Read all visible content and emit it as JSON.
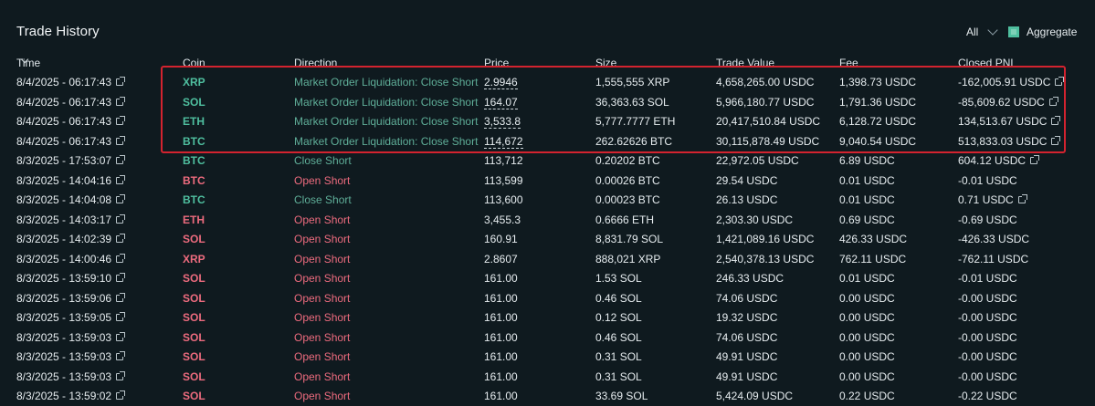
{
  "header": {
    "title": "Trade History",
    "filter_label": "All",
    "aggregate_label": "Aggregate",
    "aggregate_checked": true
  },
  "columns": {
    "time": "Time",
    "coin": "Coin",
    "direction": "Direction",
    "price": "Price",
    "size": "Size",
    "trade_value": "Trade Value",
    "fee": "Fee",
    "closed_pnl": "Closed PNL"
  },
  "colors": {
    "buy": "#4fbf9f",
    "sell": "#ed6b7e",
    "highlight": "#d3232f"
  },
  "rows": [
    {
      "time": "8/4/2025 - 06:17:43",
      "coin": "XRP",
      "direction": "Market Order Liquidation: Close Short",
      "price": "2.9946",
      "size": "1,555,555 XRP",
      "trade_value": "4,658,265.00 USDC",
      "fee": "1,398.73 USDC",
      "pnl": "-162,005.91 USDC",
      "pnl_link": true,
      "side": "close",
      "price_dotted": true
    },
    {
      "time": "8/4/2025 - 06:17:43",
      "coin": "SOL",
      "direction": "Market Order Liquidation: Close Short",
      "price": "164.07",
      "size": "36,363.63 SOL",
      "trade_value": "5,966,180.77 USDC",
      "fee": "1,791.36 USDC",
      "pnl": "-85,609.62 USDC",
      "pnl_link": true,
      "side": "close",
      "price_dotted": true
    },
    {
      "time": "8/4/2025 - 06:17:43",
      "coin": "ETH",
      "direction": "Market Order Liquidation: Close Short",
      "price": "3,533.8",
      "size": "5,777.7777 ETH",
      "trade_value": "20,417,510.84 USDC",
      "fee": "6,128.72 USDC",
      "pnl": "134,513.67 USDC",
      "pnl_link": true,
      "side": "close",
      "price_dotted": true
    },
    {
      "time": "8/4/2025 - 06:17:43",
      "coin": "BTC",
      "direction": "Market Order Liquidation: Close Short",
      "price": "114,672",
      "size": "262.62626 BTC",
      "trade_value": "30,115,878.49 USDC",
      "fee": "9,040.54 USDC",
      "pnl": "513,833.03 USDC",
      "pnl_link": true,
      "side": "close",
      "price_dotted": true
    },
    {
      "time": "8/3/2025 - 17:53:07",
      "coin": "BTC",
      "direction": "Close Short",
      "price": "113,712",
      "size": "0.20202 BTC",
      "trade_value": "22,972.05 USDC",
      "fee": "6.89 USDC",
      "pnl": "604.12 USDC",
      "pnl_link": true,
      "side": "close",
      "price_dotted": false
    },
    {
      "time": "8/3/2025 - 14:04:16",
      "coin": "BTC",
      "direction": "Open Short",
      "price": "113,599",
      "size": "0.00026 BTC",
      "trade_value": "29.54 USDC",
      "fee": "0.01 USDC",
      "pnl": "-0.01 USDC",
      "pnl_link": false,
      "side": "open",
      "price_dotted": false
    },
    {
      "time": "8/3/2025 - 14:04:08",
      "coin": "BTC",
      "direction": "Close Short",
      "price": "113,600",
      "size": "0.00023 BTC",
      "trade_value": "26.13 USDC",
      "fee": "0.01 USDC",
      "pnl": "0.71 USDC",
      "pnl_link": true,
      "side": "close",
      "price_dotted": false
    },
    {
      "time": "8/3/2025 - 14:03:17",
      "coin": "ETH",
      "direction": "Open Short",
      "price": "3,455.3",
      "size": "0.6666 ETH",
      "trade_value": "2,303.30 USDC",
      "fee": "0.69 USDC",
      "pnl": "-0.69 USDC",
      "pnl_link": false,
      "side": "open",
      "price_dotted": false
    },
    {
      "time": "8/3/2025 - 14:02:39",
      "coin": "SOL",
      "direction": "Open Short",
      "price": "160.91",
      "size": "8,831.79 SOL",
      "trade_value": "1,421,089.16 USDC",
      "fee": "426.33 USDC",
      "pnl": "-426.33 USDC",
      "pnl_link": false,
      "side": "open",
      "price_dotted": false
    },
    {
      "time": "8/3/2025 - 14:00:46",
      "coin": "XRP",
      "direction": "Open Short",
      "price": "2.8607",
      "size": "888,021 XRP",
      "trade_value": "2,540,378.13 USDC",
      "fee": "762.11 USDC",
      "pnl": "-762.11 USDC",
      "pnl_link": false,
      "side": "open",
      "price_dotted": false
    },
    {
      "time": "8/3/2025 - 13:59:10",
      "coin": "SOL",
      "direction": "Open Short",
      "price": "161.00",
      "size": "1.53 SOL",
      "trade_value": "246.33 USDC",
      "fee": "0.01 USDC",
      "pnl": "-0.01 USDC",
      "pnl_link": false,
      "side": "open",
      "price_dotted": false
    },
    {
      "time": "8/3/2025 - 13:59:06",
      "coin": "SOL",
      "direction": "Open Short",
      "price": "161.00",
      "size": "0.46 SOL",
      "trade_value": "74.06 USDC",
      "fee": "0.00 USDC",
      "pnl": "-0.00 USDC",
      "pnl_link": false,
      "side": "open",
      "price_dotted": false
    },
    {
      "time": "8/3/2025 - 13:59:05",
      "coin": "SOL",
      "direction": "Open Short",
      "price": "161.00",
      "size": "0.12 SOL",
      "trade_value": "19.32 USDC",
      "fee": "0.00 USDC",
      "pnl": "-0.00 USDC",
      "pnl_link": false,
      "side": "open",
      "price_dotted": false
    },
    {
      "time": "8/3/2025 - 13:59:03",
      "coin": "SOL",
      "direction": "Open Short",
      "price": "161.00",
      "size": "0.46 SOL",
      "trade_value": "74.06 USDC",
      "fee": "0.00 USDC",
      "pnl": "-0.00 USDC",
      "pnl_link": false,
      "side": "open",
      "price_dotted": false
    },
    {
      "time": "8/3/2025 - 13:59:03",
      "coin": "SOL",
      "direction": "Open Short",
      "price": "161.00",
      "size": "0.31 SOL",
      "trade_value": "49.91 USDC",
      "fee": "0.00 USDC",
      "pnl": "-0.00 USDC",
      "pnl_link": false,
      "side": "open",
      "price_dotted": false
    },
    {
      "time": "8/3/2025 - 13:59:03",
      "coin": "SOL",
      "direction": "Open Short",
      "price": "161.00",
      "size": "0.31 SOL",
      "trade_value": "49.91 USDC",
      "fee": "0.00 USDC",
      "pnl": "-0.00 USDC",
      "pnl_link": false,
      "side": "open",
      "price_dotted": false
    },
    {
      "time": "8/3/2025 - 13:59:02",
      "coin": "SOL",
      "direction": "Open Short",
      "price": "161.00",
      "size": "33.69 SOL",
      "trade_value": "5,424.09 USDC",
      "fee": "0.22 USDC",
      "pnl": "-0.22 USDC",
      "pnl_link": false,
      "side": "open",
      "price_dotted": false
    }
  ]
}
